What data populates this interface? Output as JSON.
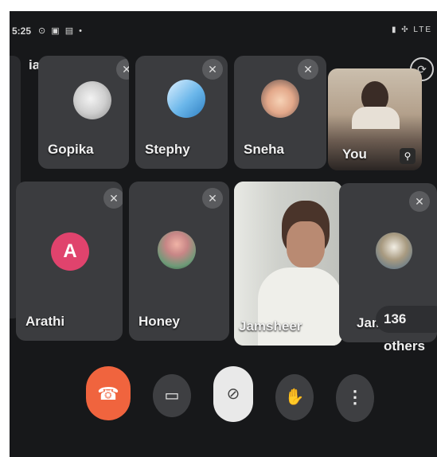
{
  "status_bar": {
    "time": "5:25",
    "left_icons": "⊙ ▣ ▤ •",
    "right_icons": "▮ ✣ LTE"
  },
  "meeting": {
    "code": "iaj-iedt-hrq",
    "chevron": "▸"
  },
  "participants": [
    {
      "name": "Gopika",
      "muted": true
    },
    {
      "name": "Stephy",
      "muted": true
    },
    {
      "name": "Sneha",
      "muted": true
    },
    {
      "name": "You",
      "muted": true
    },
    {
      "name": "Arathi",
      "muted": true,
      "avatar_letter": "A"
    },
    {
      "name": "Honey",
      "muted": true
    },
    {
      "name": "Jamsheer",
      "muted": false
    },
    {
      "name": "Jams",
      "muted": true
    }
  ],
  "others_count": "136 others",
  "controls": [
    {
      "label": "end call",
      "icon": "phone-hangup-icon"
    },
    {
      "label": "camera",
      "icon": "camera-icon"
    },
    {
      "label": "microphone",
      "icon": "mic-off-icon"
    },
    {
      "label": "raise hand",
      "icon": "hand-icon"
    },
    {
      "label": "more options",
      "icon": "more-vert-icon"
    }
  ],
  "colors": {
    "end_call": "#f0643e",
    "avatar_arathi": "#e0436d",
    "tile": "#3b3c3f",
    "background": "#17181a"
  }
}
